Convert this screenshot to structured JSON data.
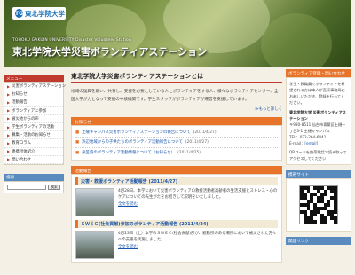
{
  "header": {
    "logo_mark": "TG",
    "logo_text": "東北学院大学",
    "en_title": "TOHOKU GAKUIN UNIVERSITY  Disaster Volunteer Station",
    "jp_title": "東北学院大学災害ボランティアステーション"
  },
  "leftnav": {
    "head": "メニュー",
    "items": [
      "災害ボランティアステーション",
      "お知らせ",
      "活動報告",
      "ボランティアに参加",
      "被災地からの声",
      "学生ボランティアの活動",
      "募集・活動のお知らせ",
      "教育コラム",
      "連携団体紹介",
      "問い合わせ"
    ],
    "search_head": "検索",
    "search_button": "検索"
  },
  "main": {
    "about_title": "東北学院大学災害ボランティアステーションとは",
    "about_text": "地域の復興を願い、共育し、支援を必要としている人とボランティアをする人、様々なボランティアセンター、全国大学が力となって支援の中核機関です。学生スタッフがボランティアが運営を支援しています。",
    "more": "≫もっと詳しく",
    "news_head": "お知らせ",
    "news": [
      {
        "title": "土曜キャンパス災害ボランティアステーションの報告について",
        "date": "(2011/4/27)"
      },
      {
        "title": "浜辺地域からの子供たちのボランティア活動報告について",
        "date": "(2011/4/27)"
      },
      {
        "title": "泉区内のボランティア活動情報について（お知らせ）",
        "date": "(2011/4/25)"
      }
    ],
    "report_head": "活動報告",
    "reports": [
      {
        "title": "災害・救援ボランティア活動報告 (2011/4/27)",
        "text": "4月28日、本学において災害ボランティアの救援活動者高齢者の生活支援とストレス・心のケアについての先生がたをお招きして説明をいたしました。",
        "link": "全文を読む"
      },
      {
        "title": "ＳＷＥＣ(社会貢献)参加のボランティア活動報告 (2011/4/24)",
        "text": "4月23日（土）本学のＳＷＥＣ(社会貢献)部が、避難所のある場所において被災された方々への支援を実施しました。",
        "link": "全文を読む"
      }
    ]
  },
  "right": {
    "head": "ボランティア登録・問い合わせ",
    "intro": "学生・教職員でボランティアを希望される方は本人が直接事務局にお越しいただき、登録を行ってください。",
    "org_name": "東北学院大学 災害ボランティアステーション",
    "address": "〒980-8511 仙台市青葉区土樋一丁目3-1 土樋キャンパス",
    "phone": "TEL：022-264-6441",
    "email_label": "E-mail：",
    "email": "[email]",
    "mobile_head": "携帯サイト",
    "note": "QRコードを携帯電話で読み取ってアクセスしてください",
    "links_head": "関連リンク",
    "qr_pattern": "1110111011110100101011110110110011101011001100110110101111010011010010111100111011100111010110101100111001101101111011001110111"
  },
  "colors": {
    "accent_red": "#c13a2f",
    "accent_orange": "#e8742a",
    "accent_blue": "#5a8bbf",
    "link": "#1a55a8"
  }
}
